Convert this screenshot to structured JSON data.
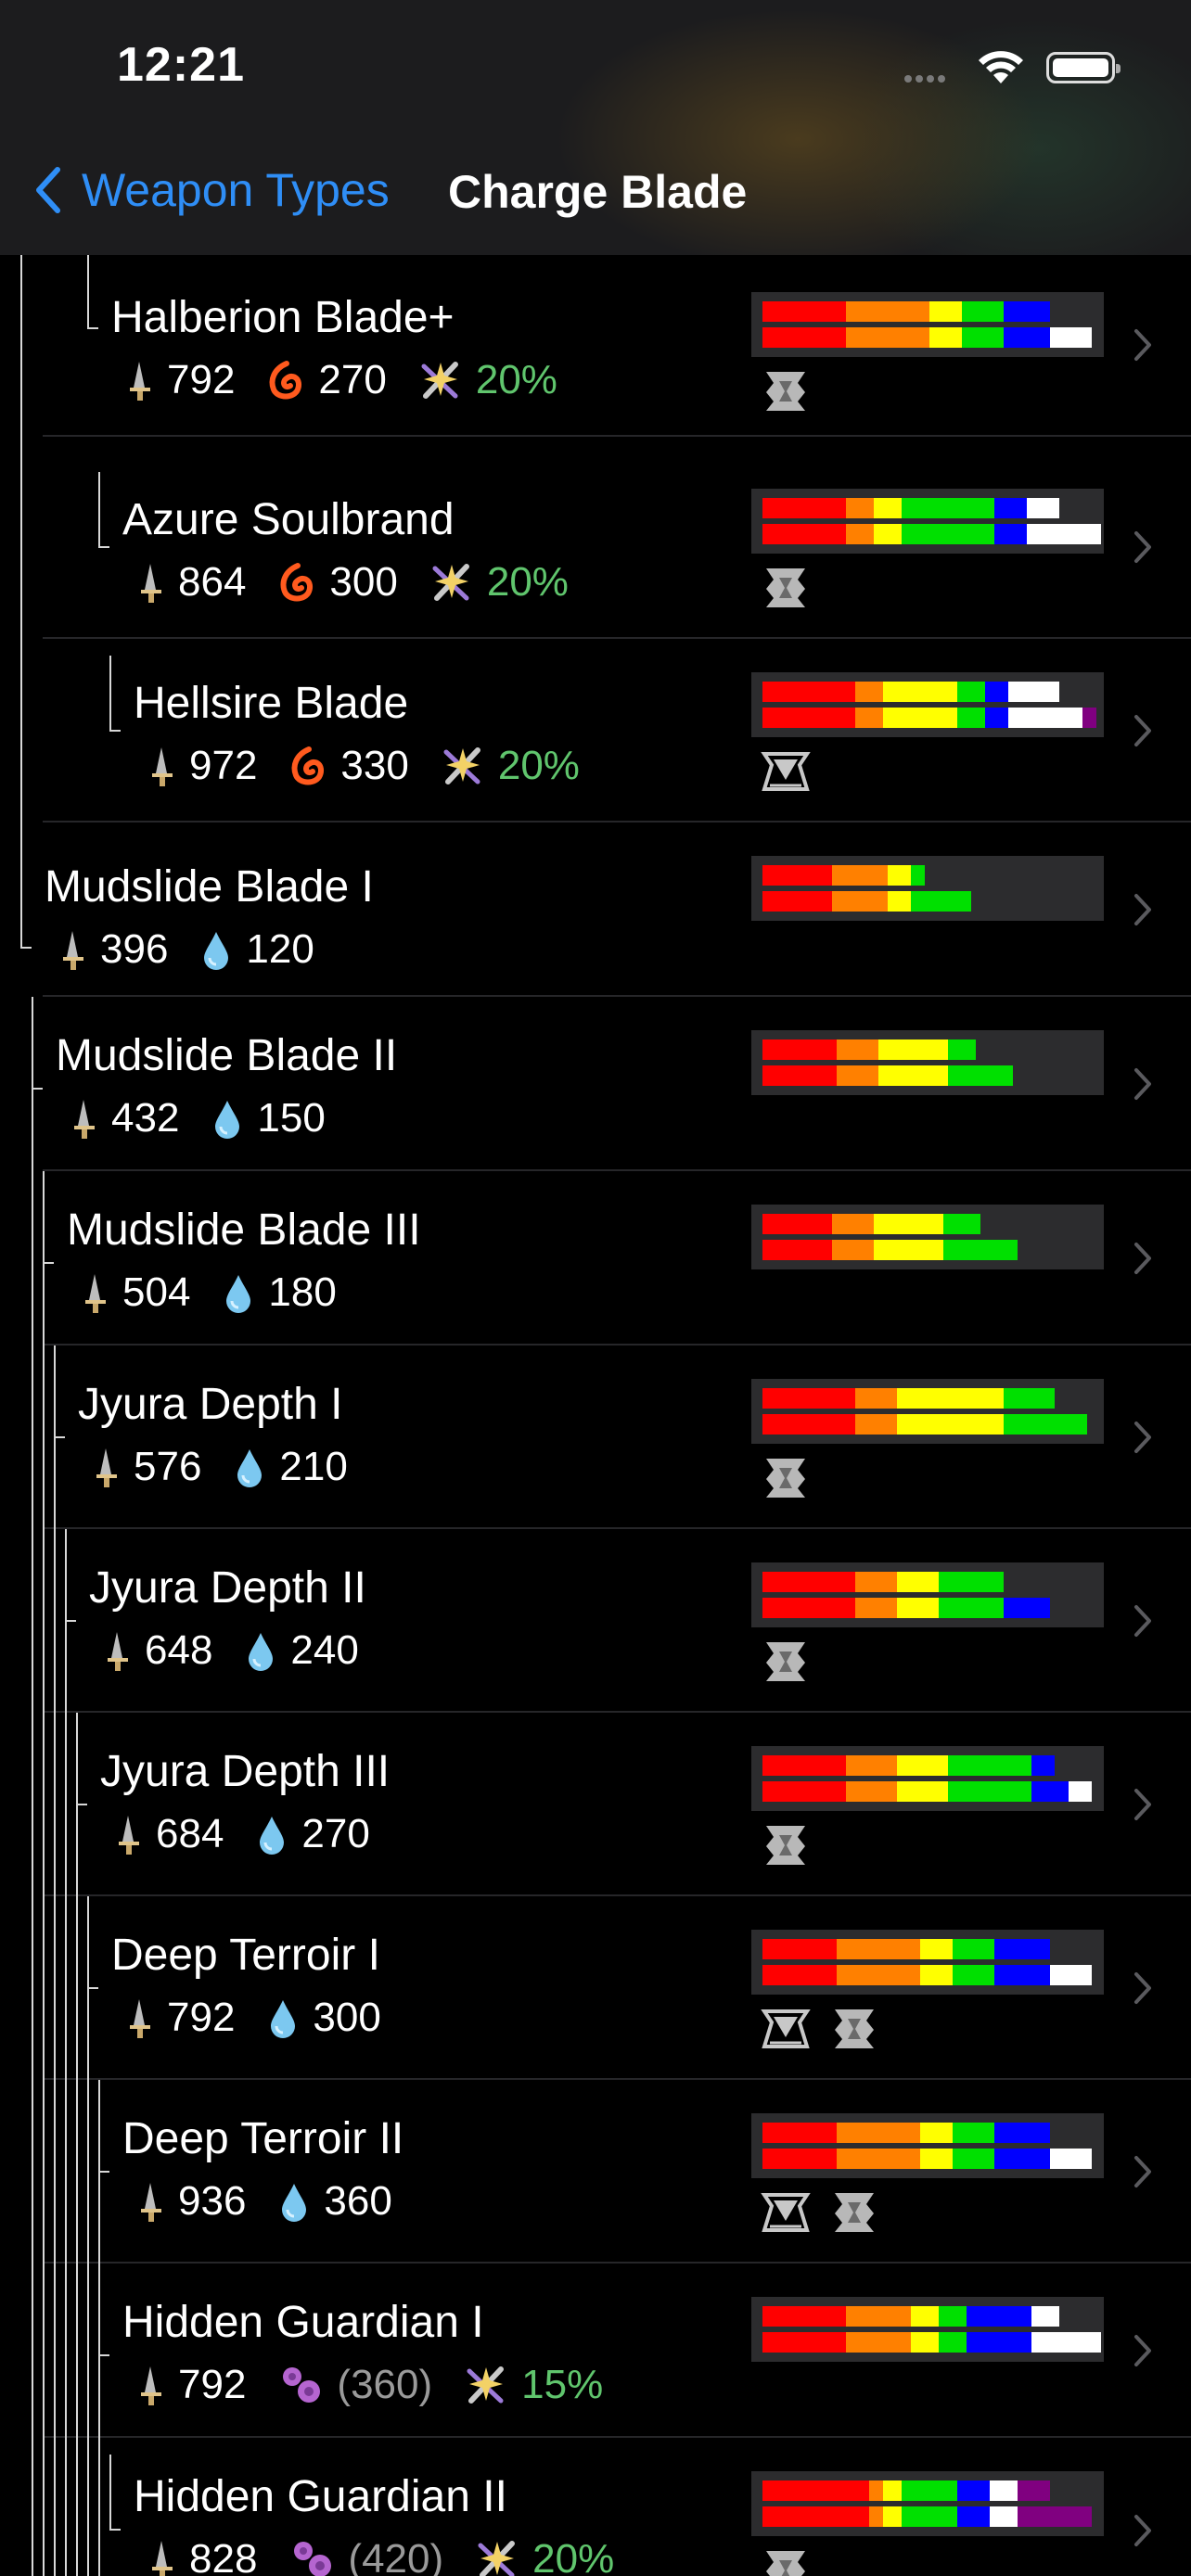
{
  "status_bar": {
    "time": "12:21"
  },
  "nav": {
    "back_label": "Weapon Types",
    "title": "Charge Blade"
  },
  "colors": {
    "accent": "#2f8ef6",
    "affinity": "#60c56d",
    "red": "#ff0000",
    "orange": "#ff8000",
    "yellow": "#ffff00",
    "green": "#00e000",
    "blue": "#0000ff",
    "white": "#ffffff",
    "purple": "#800080"
  },
  "weapons": [
    {
      "name": "Halberion Blade+",
      "attack": "792",
      "element": "fire",
      "element_value": "270",
      "affinity": "20%",
      "slots": [
        "slot-1"
      ],
      "sharpness": [
        [
          [
            "red",
            90
          ],
          [
            "orange",
            90
          ],
          [
            "yellow",
            35
          ],
          [
            "green",
            45
          ],
          [
            "blue",
            50
          ]
        ],
        [
          [
            "red",
            90
          ],
          [
            "orange",
            90
          ],
          [
            "yellow",
            35
          ],
          [
            "green",
            45
          ],
          [
            "blue",
            50
          ],
          [
            "white",
            45
          ]
        ]
      ]
    },
    {
      "name": "Azure Soulbrand",
      "attack": "864",
      "element": "fire",
      "element_value": "300",
      "affinity": "20%",
      "slots": [
        "slot-1"
      ],
      "sharpness": [
        [
          [
            "red",
            90
          ],
          [
            "orange",
            30
          ],
          [
            "yellow",
            30
          ],
          [
            "green",
            100
          ],
          [
            "blue",
            35
          ],
          [
            "white",
            35
          ]
        ],
        [
          [
            "red",
            90
          ],
          [
            "orange",
            30
          ],
          [
            "yellow",
            30
          ],
          [
            "green",
            100
          ],
          [
            "blue",
            35
          ],
          [
            "white",
            80
          ]
        ]
      ]
    },
    {
      "name": "Hellsire Blade",
      "attack": "972",
      "element": "fire",
      "element_value": "330",
      "affinity": "20%",
      "slots": [
        "slot-3"
      ],
      "sharpness": [
        [
          [
            "red",
            100
          ],
          [
            "orange",
            30
          ],
          [
            "yellow",
            80
          ],
          [
            "green",
            30
          ],
          [
            "blue",
            25
          ],
          [
            "white",
            55
          ]
        ],
        [
          [
            "red",
            100
          ],
          [
            "orange",
            30
          ],
          [
            "yellow",
            80
          ],
          [
            "green",
            30
          ],
          [
            "blue",
            25
          ],
          [
            "white",
            80
          ],
          [
            "purple",
            15
          ]
        ]
      ]
    },
    {
      "name": "Mudslide Blade I",
      "attack": "396",
      "element": "water",
      "element_value": "120",
      "slots": [],
      "sharpness": [
        [
          [
            "red",
            75
          ],
          [
            "orange",
            60
          ],
          [
            "yellow",
            25
          ],
          [
            "green",
            15
          ]
        ],
        [
          [
            "red",
            75
          ],
          [
            "orange",
            60
          ],
          [
            "yellow",
            25
          ],
          [
            "green",
            65
          ]
        ]
      ]
    },
    {
      "name": "Mudslide Blade II",
      "attack": "432",
      "element": "water",
      "element_value": "150",
      "slots": [],
      "sharpness": [
        [
          [
            "red",
            80
          ],
          [
            "orange",
            45
          ],
          [
            "yellow",
            75
          ],
          [
            "green",
            30
          ]
        ],
        [
          [
            "red",
            80
          ],
          [
            "orange",
            45
          ],
          [
            "yellow",
            75
          ],
          [
            "green",
            70
          ]
        ]
      ]
    },
    {
      "name": "Mudslide Blade III",
      "attack": "504",
      "element": "water",
      "element_value": "180",
      "slots": [],
      "sharpness": [
        [
          [
            "red",
            75
          ],
          [
            "orange",
            45
          ],
          [
            "yellow",
            75
          ],
          [
            "green",
            40
          ]
        ],
        [
          [
            "red",
            75
          ],
          [
            "orange",
            45
          ],
          [
            "yellow",
            75
          ],
          [
            "green",
            80
          ]
        ]
      ]
    },
    {
      "name": "Jyura Depth I",
      "attack": "576",
      "element": "water",
      "element_value": "210",
      "slots": [
        "slot-1"
      ],
      "sharpness": [
        [
          [
            "red",
            100
          ],
          [
            "orange",
            45
          ],
          [
            "yellow",
            115
          ],
          [
            "green",
            55
          ]
        ],
        [
          [
            "red",
            100
          ],
          [
            "orange",
            45
          ],
          [
            "yellow",
            115
          ],
          [
            "green",
            90
          ]
        ]
      ]
    },
    {
      "name": "Jyura Depth II",
      "attack": "648",
      "element": "water",
      "element_value": "240",
      "slots": [
        "slot-1"
      ],
      "sharpness": [
        [
          [
            "red",
            100
          ],
          [
            "orange",
            45
          ],
          [
            "yellow",
            45
          ],
          [
            "green",
            70
          ]
        ],
        [
          [
            "red",
            100
          ],
          [
            "orange",
            45
          ],
          [
            "yellow",
            45
          ],
          [
            "green",
            70
          ],
          [
            "blue",
            50
          ]
        ]
      ]
    },
    {
      "name": "Jyura Depth III",
      "attack": "684",
      "element": "water",
      "element_value": "270",
      "slots": [
        "slot-1"
      ],
      "sharpness": [
        [
          [
            "red",
            90
          ],
          [
            "orange",
            55
          ],
          [
            "yellow",
            55
          ],
          [
            "green",
            90
          ],
          [
            "blue",
            25
          ]
        ],
        [
          [
            "red",
            90
          ],
          [
            "orange",
            55
          ],
          [
            "yellow",
            55
          ],
          [
            "green",
            90
          ],
          [
            "blue",
            40
          ],
          [
            "white",
            25
          ]
        ]
      ]
    },
    {
      "name": "Deep Terroir I",
      "attack": "792",
      "element": "water",
      "element_value": "300",
      "slots": [
        "slot-3",
        "slot-1"
      ],
      "sharpness": [
        [
          [
            "red",
            80
          ],
          [
            "orange",
            90
          ],
          [
            "yellow",
            35
          ],
          [
            "green",
            45
          ],
          [
            "blue",
            60
          ]
        ],
        [
          [
            "red",
            80
          ],
          [
            "orange",
            90
          ],
          [
            "yellow",
            35
          ],
          [
            "green",
            45
          ],
          [
            "blue",
            60
          ],
          [
            "white",
            45
          ]
        ]
      ]
    },
    {
      "name": "Deep Terroir II",
      "attack": "936",
      "element": "water",
      "element_value": "360",
      "slots": [
        "slot-3",
        "slot-1"
      ],
      "sharpness": [
        [
          [
            "red",
            80
          ],
          [
            "orange",
            90
          ],
          [
            "yellow",
            35
          ],
          [
            "green",
            45
          ],
          [
            "blue",
            60
          ]
        ],
        [
          [
            "red",
            80
          ],
          [
            "orange",
            90
          ],
          [
            "yellow",
            35
          ],
          [
            "green",
            45
          ],
          [
            "blue",
            60
          ],
          [
            "white",
            45
          ]
        ]
      ]
    },
    {
      "name": "Hidden Guardian I",
      "attack": "792",
      "element": "dragon",
      "element_value": "(360)",
      "affinity": "15%",
      "slots": [],
      "sharpness": [
        [
          [
            "red",
            90
          ],
          [
            "orange",
            70
          ],
          [
            "yellow",
            30
          ],
          [
            "green",
            30
          ],
          [
            "blue",
            70
          ],
          [
            "white",
            30
          ]
        ],
        [
          [
            "red",
            90
          ],
          [
            "orange",
            70
          ],
          [
            "yellow",
            30
          ],
          [
            "green",
            30
          ],
          [
            "blue",
            70
          ],
          [
            "white",
            75
          ]
        ]
      ]
    },
    {
      "name": "Hidden Guardian II",
      "attack": "828",
      "element": "dragon",
      "element_value": "(420)",
      "affinity": "20%",
      "slots": [
        "slot-1"
      ],
      "sharpness": [
        [
          [
            "red",
            115
          ],
          [
            "orange",
            15
          ],
          [
            "yellow",
            20
          ],
          [
            "green",
            60
          ],
          [
            "blue",
            35
          ],
          [
            "white",
            30
          ],
          [
            "purple",
            35
          ]
        ],
        [
          [
            "red",
            115
          ],
          [
            "orange",
            15
          ],
          [
            "yellow",
            20
          ],
          [
            "green",
            60
          ],
          [
            "blue",
            35
          ],
          [
            "white",
            30
          ],
          [
            "purple",
            80
          ]
        ]
      ]
    }
  ]
}
